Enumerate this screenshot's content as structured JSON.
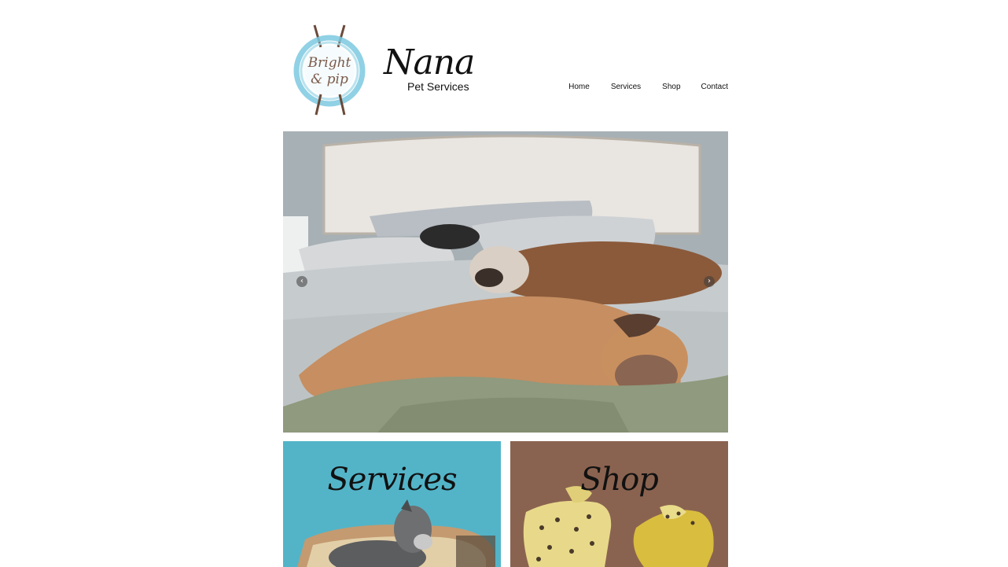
{
  "brand": {
    "partner_logo_text_line1": "Bright",
    "partner_logo_text_line2": "& pip",
    "title": "Nana",
    "subtitle": "Pet Services"
  },
  "nav": {
    "items": [
      {
        "label": "Home"
      },
      {
        "label": "Services"
      },
      {
        "label": "Shop"
      },
      {
        "label": "Contact"
      }
    ]
  },
  "slideshow": {
    "prev_icon": "chevron-left-icon",
    "next_icon": "chevron-right-icon",
    "prev_glyph": "‹",
    "next_glyph": "›"
  },
  "tiles": {
    "services": {
      "title": "Services",
      "color": "#53b4c8"
    },
    "shop": {
      "title": "Shop",
      "color": "#8a6350"
    }
  }
}
